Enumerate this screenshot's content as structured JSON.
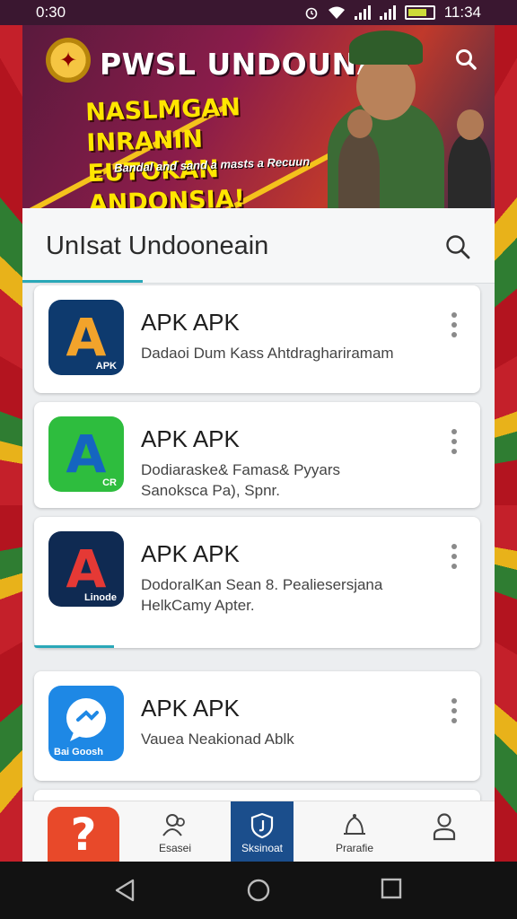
{
  "status_bar": {
    "time": "0:30",
    "clock_right": "11:34",
    "icons": [
      "alarm-icon",
      "wifi-icon",
      "signal-icon",
      "signal-icon",
      "battery-icon"
    ]
  },
  "banner": {
    "title": "PWSL UNDOUNAM",
    "headline_line1": "NASLMGAN INRANIN",
    "headline_line2": "EUTOKAN ANDONSIA!",
    "subtext": "Bandal and sand a masts a Recuun",
    "emblem_icon": "garuda-emblem-icon",
    "search_icon": "search-icon"
  },
  "section": {
    "title": "UnIsat Undooneain",
    "search_icon": "search-icon"
  },
  "apps": [
    {
      "name": "APK APK",
      "desc_line1": "Dadaoi Dum Kass Ahtdraghariramam",
      "desc_line2": "",
      "icon_letter": "A",
      "icon_tag": "APK",
      "icon_bg": "#0e3a6e",
      "icon_fg": "#f2a32b"
    },
    {
      "name": "APK APK",
      "desc_line1": "Dodiaraske& Famas& Pyyars",
      "desc_line2": "Sanokscа Pa), Spnr.",
      "icon_letter": "A",
      "icon_tag": "CR",
      "icon_bg": "#2ebd3e",
      "icon_fg": "#1565c0"
    },
    {
      "name": "APK APK",
      "desc_line1": "DodoralKan Sean 8. Pealiesersjana",
      "desc_line2": "HelkCamy Apter.",
      "icon_letter": "A",
      "icon_tag": "Linode",
      "icon_bg": "#0f2a52",
      "icon_fg": "#e53935",
      "progress": 0.18
    },
    {
      "name": "APK APK",
      "desc_line1": "Vauea Neakionad Ablk",
      "desc_line2": "",
      "icon_letter": "",
      "icon_tag": "Bai Goosh",
      "icon_bg": "#1e88e5",
      "icon_fg": "#ffffff"
    }
  ],
  "bottom_nav": {
    "items": [
      {
        "label": "Esasei",
        "icon": "users-icon"
      },
      {
        "label": "Sksinoat",
        "icon": "shield-icon",
        "active": true
      },
      {
        "label": "Prarafie",
        "icon": "bell-person-icon"
      },
      {
        "label": "",
        "icon": "profile-icon"
      }
    ]
  },
  "system_nav": {
    "icons": [
      "back-icon",
      "home-icon",
      "recents-icon"
    ]
  }
}
